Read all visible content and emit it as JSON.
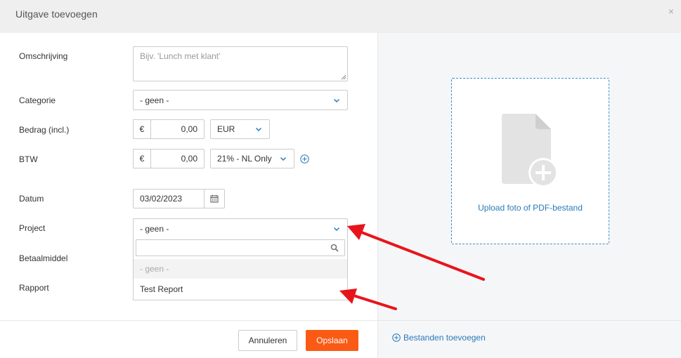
{
  "dialog": {
    "title": "Uitgave toevoegen",
    "close": "×"
  },
  "form": {
    "description": {
      "label": "Omschrijving",
      "placeholder": "Bijv. 'Lunch met klant'"
    },
    "category": {
      "label": "Categorie",
      "value": "- geen -"
    },
    "amount": {
      "label": "Bedrag (incl.)",
      "prefix": "€",
      "value": "0,00",
      "currency": "EUR"
    },
    "vat": {
      "label": "BTW",
      "prefix": "€",
      "value": "0,00",
      "rate": "21% - NL Only"
    },
    "date": {
      "label": "Datum",
      "value": "03/02/2023"
    },
    "project": {
      "label": "Project",
      "value": "- geen -",
      "options": [
        "- geen -",
        "Test Report"
      ]
    },
    "payment_method": {
      "label": "Betaalmiddel"
    },
    "report": {
      "label": "Rapport"
    }
  },
  "footer": {
    "cancel_label": "Annuleren",
    "save_label": "Opslaan",
    "add_files_label": "Bestanden toevoegen"
  },
  "upload": {
    "label": "Upload foto of PDF-bestand",
    "icon": "file-add-icon"
  },
  "colors": {
    "accent": "#fa5a14",
    "link": "#2a7ab8",
    "annotation_arrow": "#e8141c"
  }
}
